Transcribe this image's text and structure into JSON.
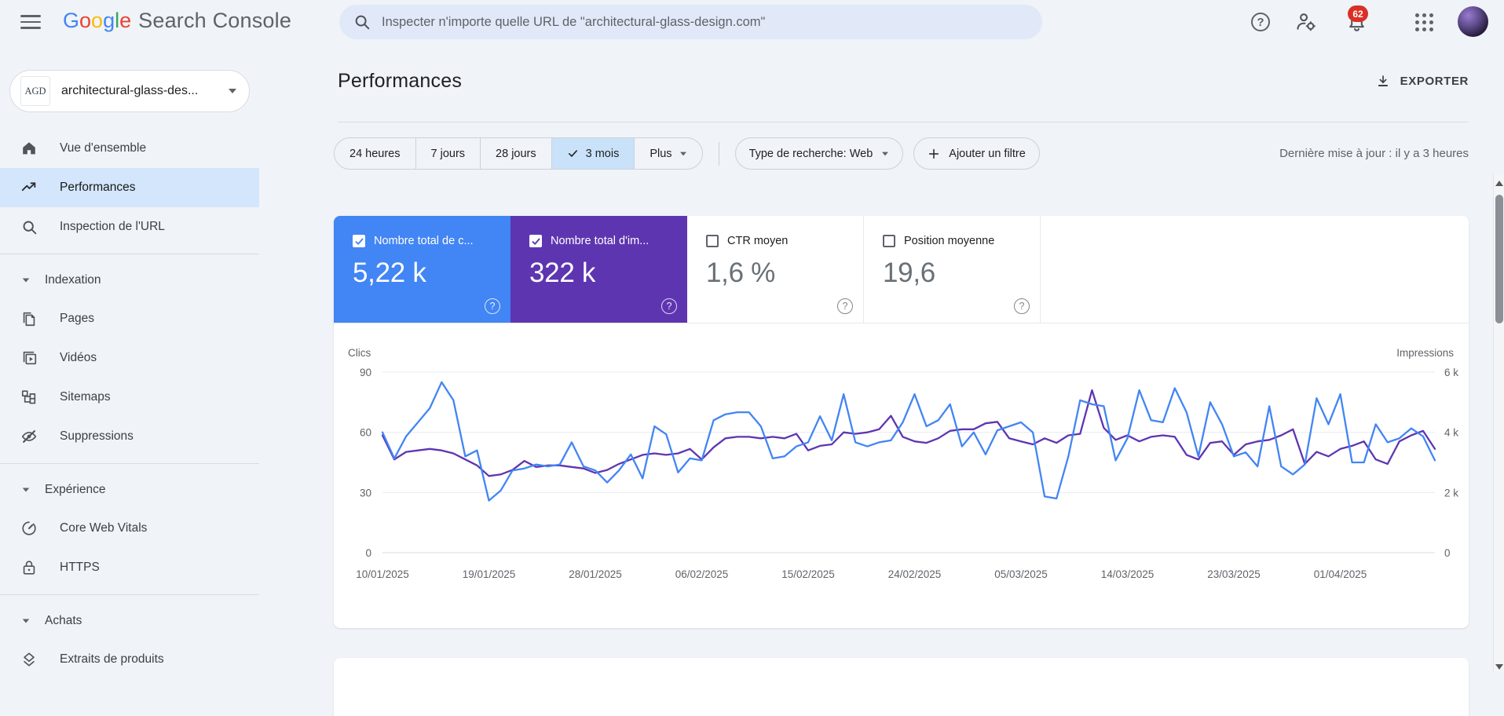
{
  "topbar": {
    "logo_letters": [
      "G",
      "o",
      "o",
      "g",
      "l",
      "e"
    ],
    "logo_suffix": "Search Console",
    "search_placeholder": "Inspecter n'importe quelle URL de \"architectural-glass-design.com\"",
    "notification_count": "62"
  },
  "icons": {
    "question": "?"
  },
  "sidebar": {
    "property_initials": "AGD",
    "property_name": "architectural-glass-des...",
    "items": {
      "overview": "Vue d'ensemble",
      "performance": "Performances",
      "url_inspection": "Inspection de l'URL"
    },
    "sections": {
      "indexing": {
        "header": "Indexation",
        "pages": "Pages",
        "videos": "Vidéos",
        "sitemaps": "Sitemaps",
        "removals": "Suppressions"
      },
      "experience": {
        "header": "Expérience",
        "cwv": "Core Web Vitals",
        "https": "HTTPS"
      },
      "shopping": {
        "header": "Achats",
        "product_snippets": "Extraits de produits"
      }
    }
  },
  "main": {
    "title": "Performances",
    "export_label": "EXPORTER",
    "last_updated": "Dernière mise à jour : il y a 3 heures",
    "chips": {
      "h24": "24 heures",
      "d7": "7 jours",
      "d28": "28 jours",
      "m3": "3 mois",
      "more": "Plus",
      "search_type": "Type de recherche: Web",
      "add_filter": "Ajouter un filtre"
    },
    "cards": {
      "clicks": {
        "label": "Nombre total de c...",
        "value": "5,22 k",
        "checked": true,
        "color": "#4285f4"
      },
      "impressions": {
        "label": "Nombre total d'im...",
        "value": "322 k",
        "checked": true,
        "color": "#5e35b1"
      },
      "ctr": {
        "label": "CTR moyen",
        "value": "1,6 %",
        "checked": false
      },
      "position": {
        "label": "Position moyenne",
        "value": "19,6",
        "checked": false
      }
    }
  },
  "colors": {
    "clicks_blue": "#4285f4",
    "impressions_purple": "#5e35b1",
    "badge_red": "#d93025",
    "selected_chip_bg": "#c9e2fa",
    "selected_nav_bg": "#d3e6fb"
  },
  "chart_data": {
    "type": "line",
    "title": "",
    "x_labels": [
      "10/01/2025",
      "19/01/2025",
      "28/01/2025",
      "06/02/2025",
      "15/02/2025",
      "24/02/2025",
      "05/03/2025",
      "14/03/2025",
      "23/03/2025",
      "01/04/2025"
    ],
    "label_every": 9,
    "grid": true,
    "left_axis": {
      "label": "Clics",
      "ticks": [
        0,
        30,
        60,
        90
      ],
      "range": [
        0,
        90
      ]
    },
    "right_axis": {
      "label": "Impressions",
      "ticks": [
        "0",
        "2 k",
        "4 k",
        "6 k"
      ],
      "tick_values": [
        0,
        2000,
        4000,
        6000
      ],
      "range": [
        0,
        6000
      ]
    },
    "series": [
      {
        "name": "Clics",
        "axis": "left",
        "color": "#4285f4",
        "values": [
          60,
          47,
          58,
          65,
          72,
          85,
          76,
          48,
          51,
          26,
          31,
          41,
          42,
          44,
          43,
          44,
          55,
          43,
          41,
          35,
          41,
          49,
          37,
          63,
          59,
          40,
          47,
          46,
          66,
          69,
          70,
          70,
          63,
          47,
          48,
          53,
          55,
          68,
          56,
          79,
          55,
          53,
          55,
          56,
          65,
          79,
          63,
          66,
          74,
          53,
          60,
          49,
          61,
          63,
          65,
          60,
          28,
          27,
          48,
          76,
          74,
          73,
          46,
          57,
          81,
          66,
          65,
          82,
          70,
          48,
          75,
          64,
          48,
          50,
          43,
          73,
          43,
          39,
          44,
          77,
          64,
          79,
          45,
          45,
          64,
          55,
          57,
          62,
          58,
          46
        ]
      },
      {
        "name": "Impressions",
        "axis": "right",
        "color": "#5e35b1",
        "values": [
          3900,
          3100,
          3350,
          3400,
          3450,
          3400,
          3300,
          3100,
          2900,
          2550,
          2600,
          2750,
          3050,
          2850,
          2900,
          2900,
          2850,
          2800,
          2650,
          2750,
          2950,
          3100,
          3250,
          3300,
          3250,
          3300,
          3450,
          3100,
          3500,
          3800,
          3850,
          3850,
          3800,
          3850,
          3800,
          3950,
          3400,
          3550,
          3600,
          4000,
          3950,
          4000,
          4100,
          4550,
          3850,
          3700,
          3650,
          3800,
          4050,
          4100,
          4100,
          4300,
          4350,
          3800,
          3700,
          3600,
          3800,
          3650,
          3900,
          3950,
          5400,
          4150,
          3750,
          3900,
          3700,
          3850,
          3900,
          3850,
          3250,
          3100,
          3650,
          3700,
          3250,
          3600,
          3700,
          3750,
          3900,
          4100,
          2950,
          3350,
          3200,
          3450,
          3550,
          3700,
          3100,
          2950,
          3700,
          3900,
          4050,
          3450
        ]
      }
    ]
  }
}
